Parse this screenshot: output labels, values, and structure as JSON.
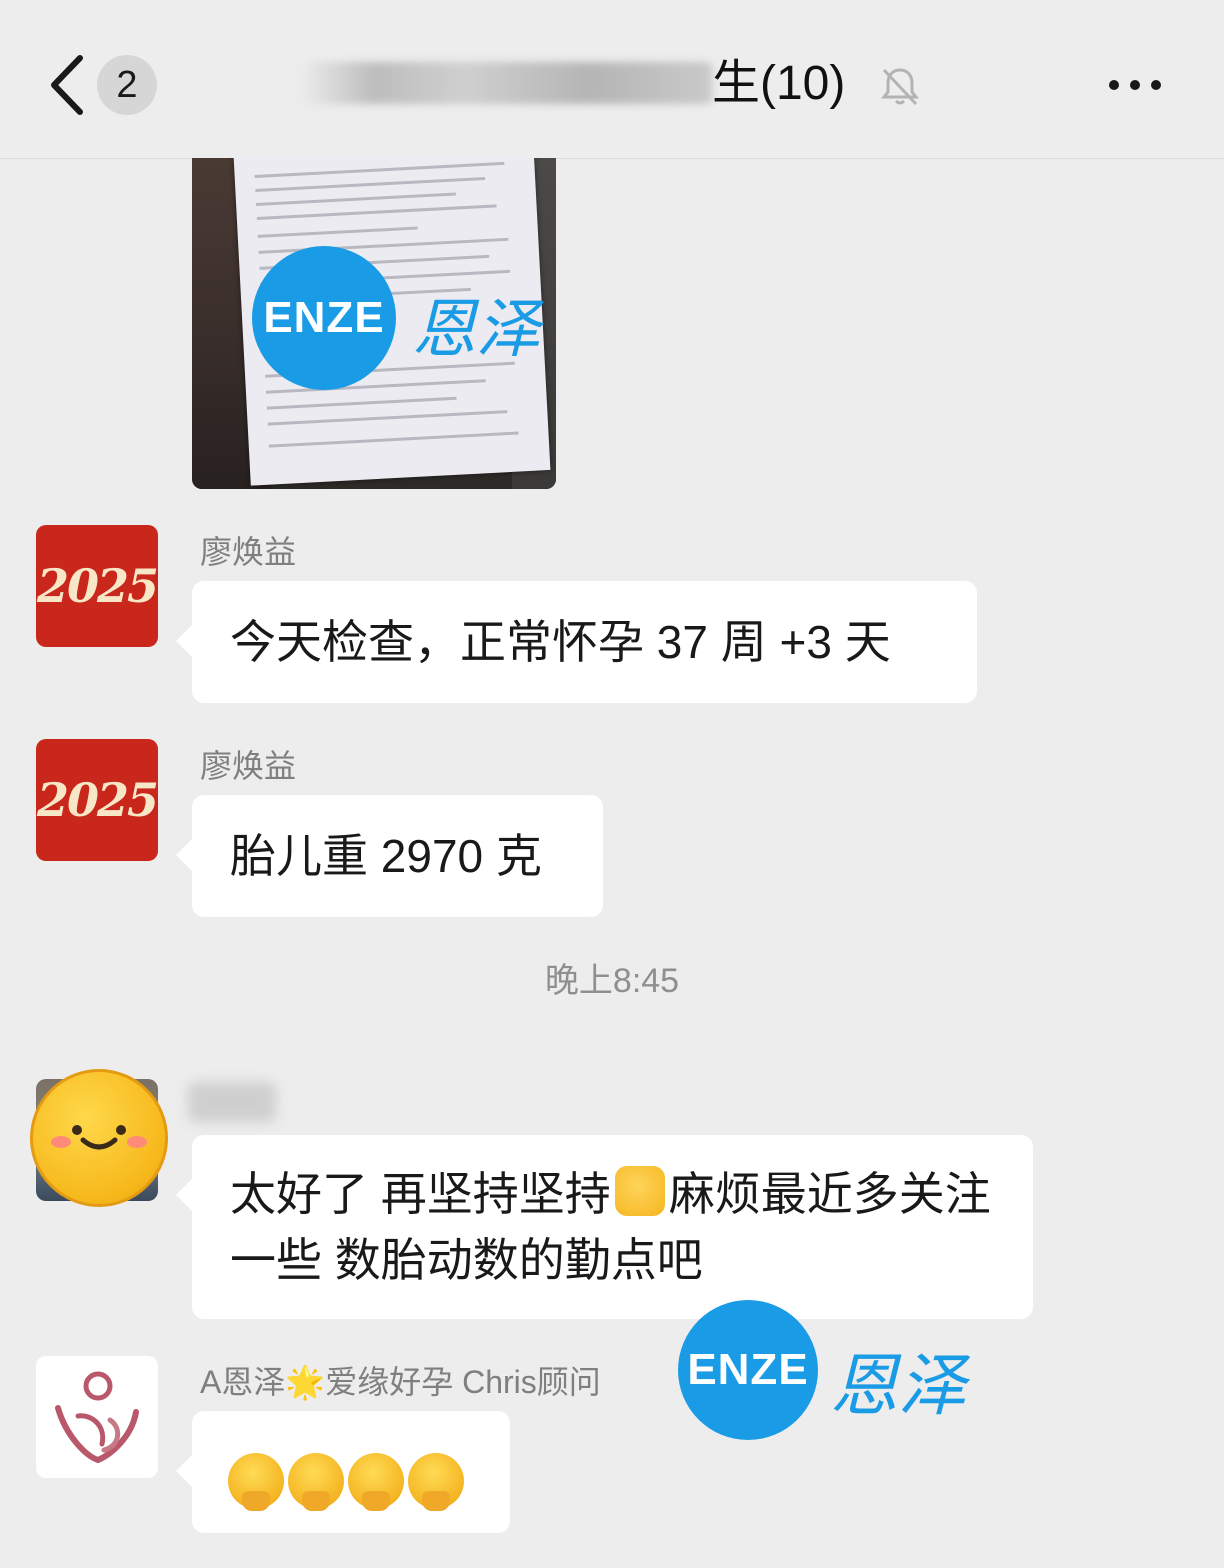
{
  "header": {
    "back_icon": "chevron-left-icon",
    "unread_count": "2",
    "title": "生(10)",
    "mute_icon": "bell-muted-icon",
    "more_icon": "more-dots-icon"
  },
  "watermark": {
    "logo_text": "ENZE",
    "text": "恩泽",
    "color": "#1a9be5"
  },
  "messages": [
    {
      "sender": "廖焕益",
      "avatar_text": "2025",
      "text": "今天检查，正常怀孕 37 周 +3 天"
    },
    {
      "sender": "廖焕益",
      "avatar_text": "2025",
      "text": "胎儿重 2970 克"
    },
    {
      "text_part1": "太好了 再坚持坚持",
      "emoji": "fist-emoji",
      "text_part2": "麻烦最近多关注一些 数胎动数的勤点吧"
    },
    {
      "sender": "A恩泽🌟爱缘好孕 Chris顾问",
      "emojis": [
        "hand-over-mouth-emoji",
        "hand-over-mouth-emoji",
        "hand-over-mouth-emoji",
        "hand-over-mouth-emoji"
      ]
    }
  ],
  "timestamp": "晚上8:45",
  "colors": {
    "background": "#ededed",
    "bubble": "#ffffff",
    "name": "#7f7f7f",
    "avatar_red": "#c9261c"
  }
}
